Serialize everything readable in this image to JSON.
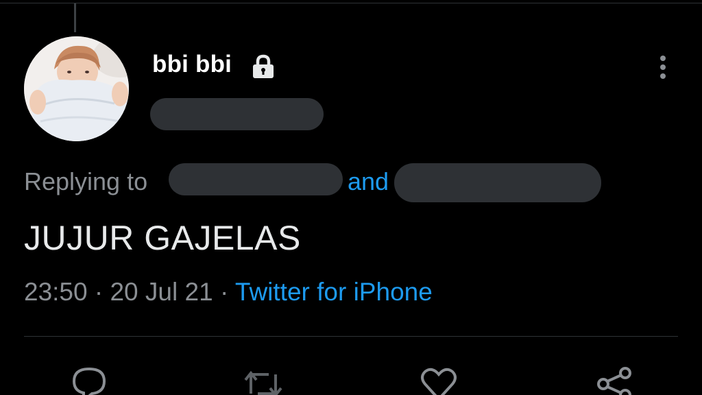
{
  "tweet": {
    "display_name": "bbi bbi",
    "replying_label": "Replying to",
    "replying_and": "and",
    "text": "JUJUR GAJELAS",
    "time": "23:50",
    "separator": "·",
    "date": "20 Jul 21",
    "source": "Twitter for iPhone"
  },
  "icons": {
    "lock": "lock-icon",
    "more": "more-vertical-icon",
    "reply": "reply-icon",
    "retweet": "retweet-icon",
    "like": "heart-icon",
    "share": "share-icon"
  },
  "colors": {
    "background": "#000000",
    "link": "#1d9bf0",
    "secondary_text": "#8b8f94",
    "primary_text": "#e7e9ea",
    "redaction": "#2e3135"
  }
}
